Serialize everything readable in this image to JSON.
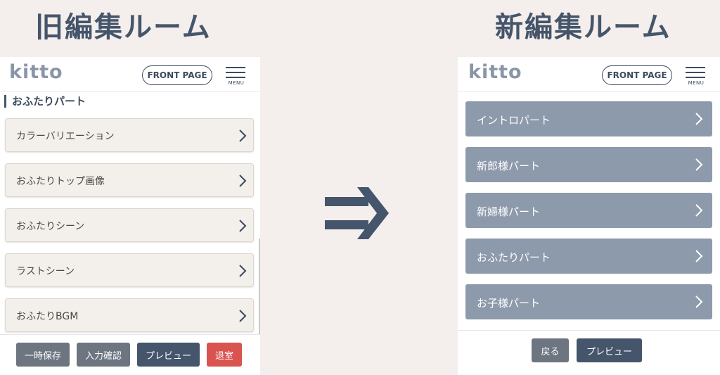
{
  "headings": {
    "old": "旧編集ルーム",
    "new": "新編集ルーム"
  },
  "colors": {
    "background": "#f4efec",
    "navy": "#45556b",
    "old_item_bg": "#f3efea",
    "new_item_bg": "#8d9aab",
    "gray_button": "#6c7580",
    "danger_button": "#d9534f"
  },
  "old_panel": {
    "logo": "kitto",
    "front_page": "FRONT PAGE",
    "menu_label": "MENU",
    "section_title": "おふたりパート",
    "items": [
      {
        "label": "カラーバリエーション"
      },
      {
        "label": "おふたりトップ画像"
      },
      {
        "label": "おふたりシーン"
      },
      {
        "label": "ラストシーン"
      },
      {
        "label": "おふたりBGM"
      }
    ],
    "buttons": {
      "save": "一時保存",
      "input_confirm": "入力確認",
      "preview": "プレビュー",
      "exit": "退室"
    }
  },
  "new_panel": {
    "logo": "kitto",
    "front_page": "FRONT PAGE",
    "menu_label": "MENU",
    "items": [
      {
        "label": "イントロパート"
      },
      {
        "label": "新郎様パート"
      },
      {
        "label": "新婦様パート"
      },
      {
        "label": "おふたりパート"
      },
      {
        "label": "お子様パート"
      }
    ],
    "buttons": {
      "back": "戻る",
      "preview": "プレビュー"
    }
  },
  "icons": {
    "menu": "hamburger-menu-icon",
    "chevron": "chevron-right-icon",
    "arrow": "double-line-arrow-right-icon"
  }
}
